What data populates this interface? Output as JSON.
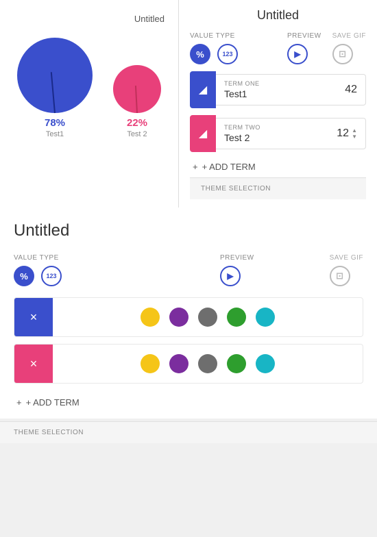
{
  "header": {
    "title": "Untitled",
    "tab_label": "Untitled"
  },
  "top_panel": {
    "chart": {
      "circle1": {
        "color": "#3a4fcc",
        "pct": "78%",
        "name": "Test1"
      },
      "circle2": {
        "color": "#e8407a",
        "pct": "22%",
        "name": "Test 2"
      }
    },
    "value_type_label": "VALUE TYPE",
    "preview_label": "PREVIEW",
    "save_gif_label": "SAVE GIF",
    "percent_btn": "%",
    "num_btn": "123",
    "term_one": {
      "label": "TERM ONE",
      "name": "Test1",
      "value": "42"
    },
    "term_two": {
      "label": "TERM TWO",
      "name": "Test 2",
      "value": "12"
    },
    "add_term_label": "+ ADD TERM",
    "theme_selection_label": "THEME SELECTION"
  },
  "bottom_panel": {
    "title": "Untitled",
    "value_type_label": "VALUE TYPE",
    "preview_label": "PREVIEW",
    "save_gif_label": "SAVE GIF",
    "percent_btn": "%",
    "num_btn": "123",
    "term1_x": "×",
    "term2_x": "×",
    "add_term_label": "+ ADD TERM",
    "theme_selection_label": "THEME SELECTION",
    "color_dots": [
      {
        "name": "yellow",
        "class": "dot-yellow"
      },
      {
        "name": "purple",
        "class": "dot-purple"
      },
      {
        "name": "gray",
        "class": "dot-gray"
      },
      {
        "name": "green",
        "class": "dot-green"
      },
      {
        "name": "teal",
        "class": "dot-teal"
      }
    ]
  },
  "icons": {
    "play": "▶",
    "save": "⊡",
    "close": "×",
    "add": "+",
    "term_icon_1": "◢",
    "term_icon_2": "◢"
  }
}
